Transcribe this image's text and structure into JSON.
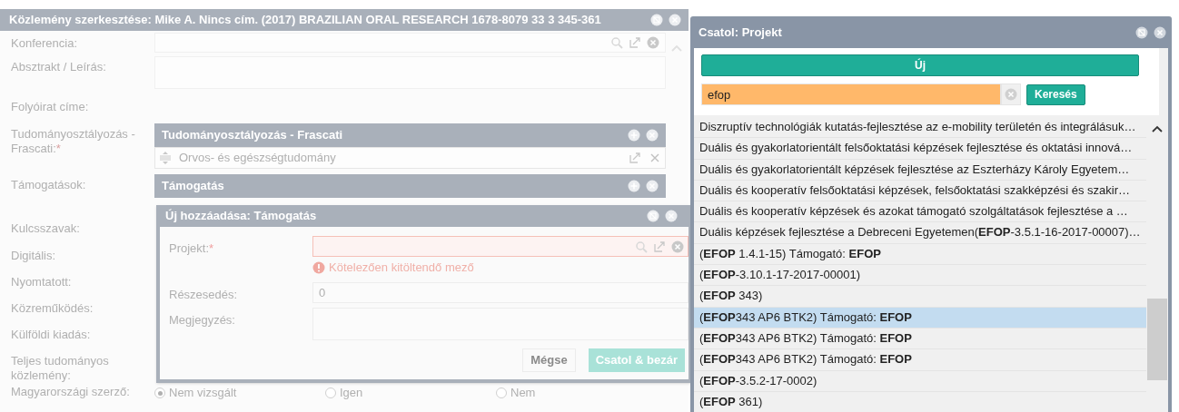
{
  "main_window": {
    "title": "Közlemény szerkesztése: Mike A. Nincs cím. (2017) BRAZILIAN ORAL RESEARCH 1678-8079 33 3 345-361",
    "fields": [
      {
        "kind": "lookup",
        "label": "Konferencia:"
      },
      {
        "kind": "textarea",
        "label": "Absztrakt / Leírás:"
      },
      {
        "kind": "plain",
        "label": "Folyóirat címe:"
      },
      {
        "kind": "panel",
        "label": "Tudományosztályozás - Frascati:",
        "required_mark": "*",
        "panel_title": "Tudományosztályozás - Frascati",
        "rows": [
          "Orvos- és egészségtudomány"
        ]
      },
      {
        "kind": "panel",
        "label": "Támogatások:",
        "panel_title": "Támogatás"
      },
      {
        "kind": "plain",
        "label": "Kulcsszavak:"
      },
      {
        "kind": "plain",
        "label": "Digitális:"
      },
      {
        "kind": "plain",
        "label": "Nyomtatott:"
      },
      {
        "kind": "plain",
        "label": "Közreműködés:"
      },
      {
        "kind": "plain",
        "label": "Külföldi kiadás:"
      },
      {
        "kind": "plain",
        "label": "Teljes tudományos közlemény:"
      },
      {
        "kind": "radio",
        "label": "Magyarországi szerző:",
        "options": [
          {
            "label": "Nem vizsgált",
            "selected": true
          },
          {
            "label": "Igen",
            "selected": false
          },
          {
            "label": "Nem",
            "selected": false
          }
        ]
      }
    ]
  },
  "add_dialog": {
    "title": "Új hozzáadása: Támogatás",
    "fields": [
      {
        "kind": "lookup",
        "label": "Projekt:",
        "required_mark": "*",
        "error": "Kötelezően kitöltendő mező"
      },
      {
        "kind": "input",
        "label": "Részesedés:",
        "value": "0"
      },
      {
        "kind": "textarea",
        "label": "Megjegyzés:"
      }
    ],
    "buttons": [
      {
        "label": "Mégse",
        "kind": "secondary"
      },
      {
        "label": "Csatol & bezár",
        "kind": "primary"
      }
    ]
  },
  "attach_dialog": {
    "title": "Csatol: Projekt",
    "new_button": "Új",
    "search": {
      "value": "efop"
    },
    "search_button": "Keresés",
    "results": [
      {
        "text": "Diszruptív technológiák kutatás-fejlesztése az e-mobility területén és integrálásuk…",
        "selected": false
      },
      {
        "text": "Duális és gyakorlatorientált felsőoktatási képzések fejlesztése és oktatási innová…",
        "selected": false
      },
      {
        "text": "Duális és gyakorlatorientált képzések fejlesztése az Eszterházy Károly Egyetem…",
        "selected": false
      },
      {
        "text": "Duális és kooperatív felsőoktatási képzések, felsőoktatási szakképzési és szakir…",
        "selected": false
      },
      {
        "text": "Duális és kooperatív képzések és azokat támogató szolgáltatások fejlesztése a …",
        "selected": false
      },
      {
        "text": "Duális képzések fejlesztése a Debreceni Egyetemen(**EFOP**-3.5.1-16-2017-00007)…",
        "selected": false
      },
      {
        "text": "(**EFOP** 1.4.1-15) Támogató: **EFOP**",
        "selected": false
      },
      {
        "text": "(**EFOP**-3.10.1-17-2017-00001)",
        "selected": false
      },
      {
        "text": "(**EFOP** 343)",
        "selected": false
      },
      {
        "text": "(**EFOP**343 AP6 BTK2) Támogató: **EFOP**",
        "selected": true
      },
      {
        "text": "(**EFOP**343 AP6 BTK2) Támogató: **EFOP**",
        "selected": false
      },
      {
        "text": "(**EFOP**343 AP6 BTK2) Támogató: **EFOP**",
        "selected": false
      },
      {
        "text": "(**EFOP**-3.5.2-17-0002)",
        "selected": false
      },
      {
        "text": "(**EFOP** 361)",
        "selected": false
      }
    ]
  }
}
